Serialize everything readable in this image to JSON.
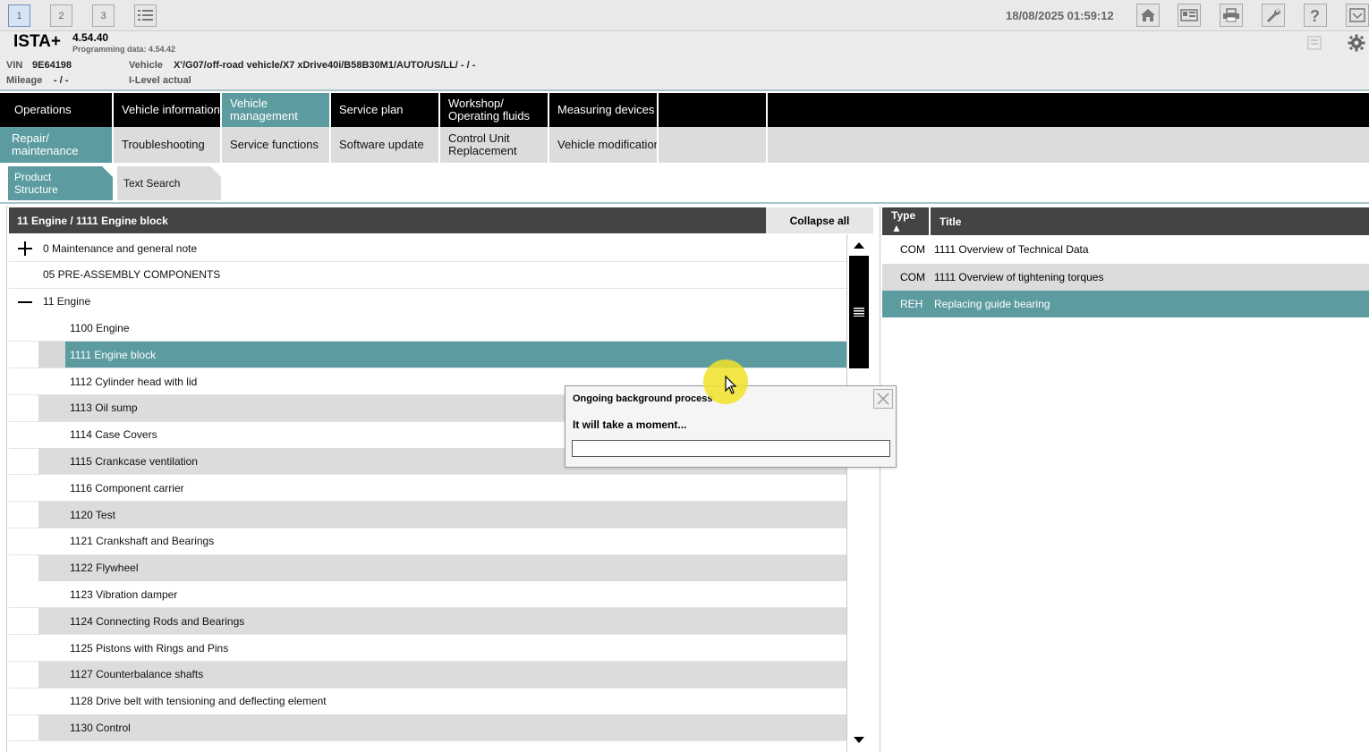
{
  "window_buttons": [
    "1",
    "2",
    "3"
  ],
  "datetime": "18/08/2025 01:59:12",
  "toolbar_icons": [
    "home-icon",
    "id-card-icon",
    "printer-icon",
    "wrench-icon",
    "help-icon",
    "dropdown-menu-icon"
  ],
  "header": {
    "app_name": "ISTA+",
    "version": "4.54.40",
    "programming_data": "Programming data:  4.54.42",
    "vin_label": "VIN",
    "vin": "9E64198",
    "mileage_label": "Mileage",
    "mileage": "- / -",
    "vehicle_label": "Vehicle",
    "vehicle": "X'/G07/off-road vehicle/X7 xDrive40i/B58B30M1/AUTO/US/LL/ - / -",
    "ilevel": "I-Level actual"
  },
  "main_nav": {
    "operations": "Operations",
    "vehicle_information": "Vehicle information",
    "vehicle_management": "Vehicle\nmanagement",
    "service_plan": "Service plan",
    "workshop": "Workshop/\nOperating fluids",
    "measuring_devices": "Measuring devices"
  },
  "sub_nav": {
    "repair": "Repair/\nmaintenance",
    "troubleshooting": "Troubleshooting",
    "service_functions": "Service functions",
    "software_update": "Software update",
    "control_unit": "Control Unit\nReplacement",
    "vehicle_modification": "Vehicle modification"
  },
  "subtabs": {
    "product_structure": "Product\nStructure",
    "text_search": "Text Search"
  },
  "tree": {
    "breadcrumb": "11 Engine / 1111 Engine block",
    "collapse_all": "Collapse all",
    "items": [
      {
        "label": "0 Maintenance and general note",
        "expander": "plus"
      },
      {
        "label": "05 PRE-ASSEMBLY COMPONENTS",
        "expander": "none"
      },
      {
        "label": "11 Engine",
        "expander": "minus"
      },
      {
        "label": "1100 Engine",
        "expander": "none"
      },
      {
        "label": "1111 Engine block",
        "expander": "none",
        "selected": true
      },
      {
        "label": "1112 Cylinder head with lid",
        "expander": "none"
      },
      {
        "label": "1113 Oil sump",
        "expander": "none"
      },
      {
        "label": "1114 Case Covers",
        "expander": "none"
      },
      {
        "label": "1115 Crankcase ventilation",
        "expander": "none"
      },
      {
        "label": "1116 Component carrier",
        "expander": "none"
      },
      {
        "label": "1120 Test",
        "expander": "none"
      },
      {
        "label": "1121 Crankshaft and Bearings",
        "expander": "none"
      },
      {
        "label": "1122 Flywheel",
        "expander": "none"
      },
      {
        "label": "1123 Vibration damper",
        "expander": "none"
      },
      {
        "label": "1124 Connecting Rods and Bearings",
        "expander": "none"
      },
      {
        "label": "1125 Pistons with Rings and Pins",
        "expander": "none"
      },
      {
        "label": "1127 Counterbalance shafts",
        "expander": "none"
      },
      {
        "label": "1128 Drive belt with tensioning and deflecting element",
        "expander": "none"
      },
      {
        "label": "1130 Control",
        "expander": "none"
      }
    ]
  },
  "documents": {
    "col_type": "Type ▲",
    "col_title": "Title",
    "rows": [
      {
        "type": "COM",
        "title": "1111 Overview of Technical Data"
      },
      {
        "type": "COM",
        "title": "1111 Overview of tightening torques"
      },
      {
        "type": "REH",
        "title": "Replacing guide bearing",
        "selected": true
      }
    ]
  },
  "dialog": {
    "title": "Ongoing background process",
    "message": "It will take a moment...",
    "progress": 0
  },
  "colors": {
    "accent": "#5c9ca0",
    "nav_bg": "#000000",
    "header_bg": "#444444",
    "row_alt": "#dcdcdc"
  }
}
